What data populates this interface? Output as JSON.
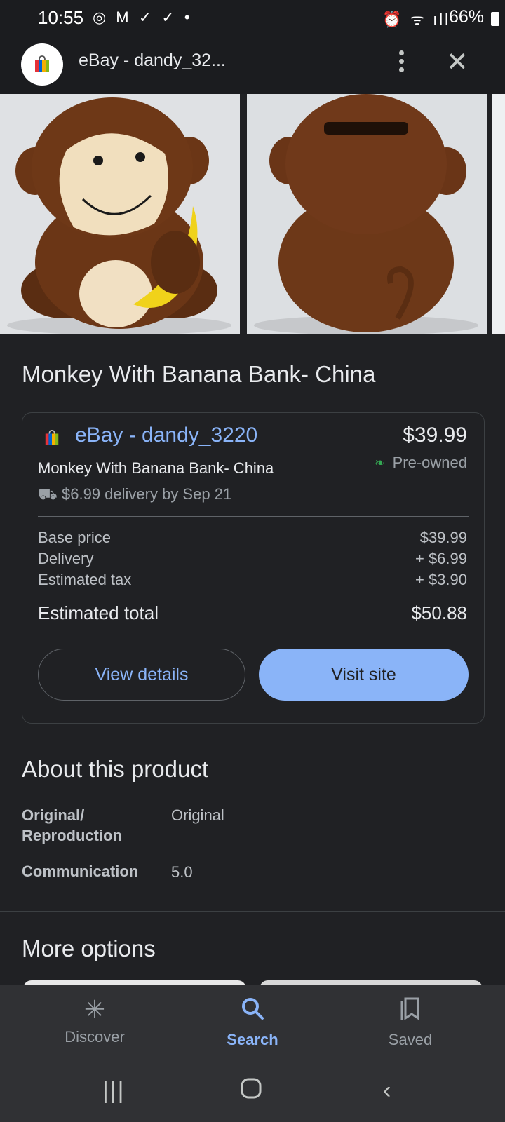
{
  "status_bar": {
    "time": "10:55",
    "left_icons": "◎ M ✓ ✓ •",
    "right_icons": "⏰ ᯤ ıll",
    "battery": "66%"
  },
  "header": {
    "title": "eBay - dandy_32...",
    "menu_icon": "more-vert-icon",
    "close_icon": "close-icon"
  },
  "product": {
    "title": "Monkey With Banana Bank- China"
  },
  "offer": {
    "seller": "eBay - dandy_3220",
    "price": "$39.99",
    "condition": "Pre-owned",
    "name": "Monkey With Banana Bank- China",
    "delivery": "$6.99 delivery by Sep 21",
    "breakdown": [
      {
        "label": "Base price",
        "value": "$39.99"
      },
      {
        "label": "Delivery",
        "value": "+ $6.99"
      },
      {
        "label": "Estimated tax",
        "value": "+ $3.90"
      }
    ],
    "total_label": "Estimated total",
    "total_value": "$50.88",
    "view_details": "View details",
    "visit_site": "Visit site"
  },
  "about": {
    "heading": "About this product",
    "specs": [
      {
        "key": "Original/\nReproduction",
        "value": "Original"
      },
      {
        "key": "Communication",
        "value": "5.0"
      }
    ]
  },
  "more_options": {
    "heading": "More options"
  },
  "bottom_nav": {
    "items": [
      {
        "label": "Discover",
        "icon": "asterisk-icon"
      },
      {
        "label": "Search",
        "icon": "search-icon"
      },
      {
        "label": "Saved",
        "icon": "bookmarks-icon"
      }
    ],
    "active": "Search"
  },
  "system_nav": {
    "recents": "recents-icon",
    "home": "home-icon",
    "back": "back-icon"
  },
  "colors": {
    "background": "#202124",
    "link": "#8ab4f8",
    "accent_button": "#8ab4f8",
    "leaf": "#34a853"
  }
}
